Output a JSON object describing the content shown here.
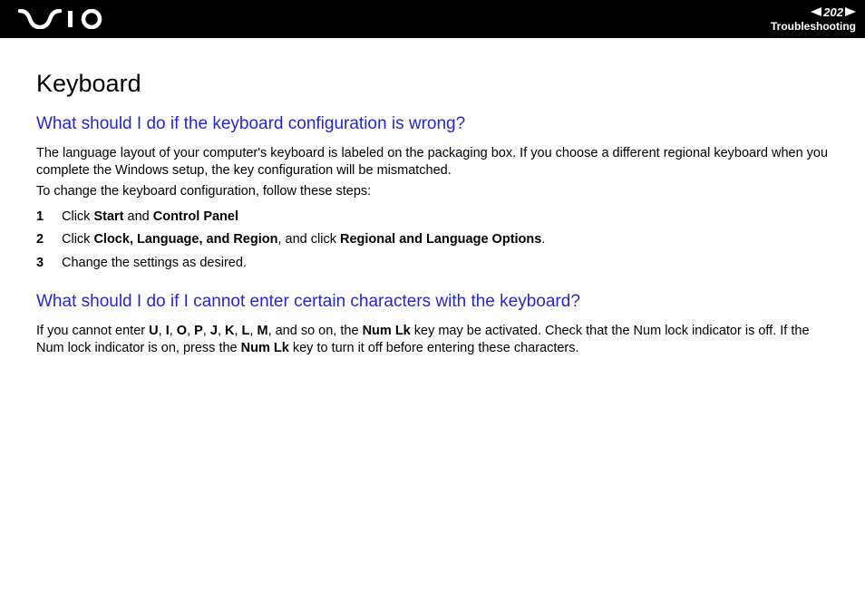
{
  "header": {
    "page_number": "202",
    "section": "Troubleshooting"
  },
  "page_title": "Keyboard",
  "section1": {
    "question": "What should I do if the keyboard configuration is wrong?",
    "intro_line1": "The language layout of your computer's keyboard is labeled on the packaging box. If you choose a different regional keyboard when you complete the Windows setup, the key configuration will be mismatched.",
    "intro_line2": "To change the keyboard configuration, follow these steps:",
    "steps": {
      "s1_a": "Click ",
      "s1_b": "Start",
      "s1_c": " and ",
      "s1_d": "Control Panel",
      "s2_a": "Click ",
      "s2_b": "Clock, Language, and Region",
      "s2_c": ", and click ",
      "s2_d": "Regional and Language Options",
      "s2_e": ".",
      "s3": "Change the settings as desired."
    }
  },
  "section2": {
    "question": "What should I do if I cannot enter certain characters with the keyboard?",
    "p_a": "If you cannot enter ",
    "p_U": "U",
    "p_c1": ", ",
    "p_I": "I",
    "p_c2": ", ",
    "p_O": "O",
    "p_c3": ", ",
    "p_P": "P",
    "p_c4": ", ",
    "p_J": "J",
    "p_c5": ", ",
    "p_K": "K",
    "p_c6": ", ",
    "p_L": "L",
    "p_c7": ", ",
    "p_M": "M",
    "p_b": ", and so on, the ",
    "p_numlk1": "Num Lk",
    "p_c": " key may be activated. Check that the Num lock indicator is off. If the Num lock indicator is on, press the ",
    "p_numlk2": "Num Lk",
    "p_d": " key to turn it off before entering these characters."
  }
}
